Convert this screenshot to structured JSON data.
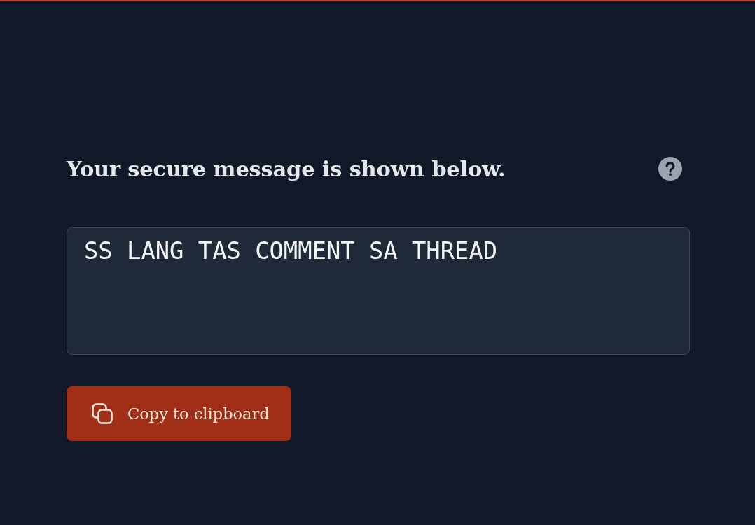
{
  "heading": "Your secure message is shown below.",
  "message": {
    "value": "SS LANG TAS COMMENT SA THREAD"
  },
  "copy_button": {
    "label": "Copy to clipboard"
  }
}
